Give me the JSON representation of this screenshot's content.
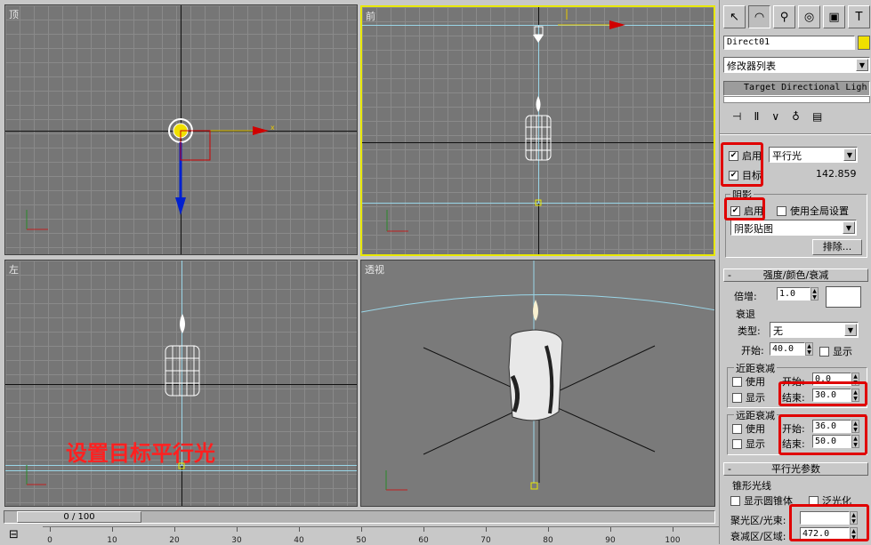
{
  "viewports": {
    "top": {
      "label": "顶"
    },
    "front": {
      "label": "前"
    },
    "left": {
      "label": "左"
    },
    "perspective": {
      "label": "透视"
    }
  },
  "caption": "设置目标平行光",
  "axis_labels": {
    "x": "x",
    "y": "y",
    "z": "z"
  },
  "command_panel": {
    "tabs": [
      "create-icon",
      "modify-icon",
      "hierarchy-icon",
      "motion-icon",
      "display-icon",
      "utilities-icon"
    ],
    "object_name": "Direct01",
    "object_color": "#f0e000",
    "modifier_list": "修改器列表",
    "stack_item": "Target Directional Ligh",
    "general": {
      "on_label": "启用",
      "light_type": "平行光",
      "target_label": "目标",
      "target_distance": "142.859",
      "shadow_group": "阴影",
      "shadow_on_label": "启用",
      "global_settings_label": "使用全局设置",
      "shadow_type": "阴影贴图",
      "exclude_button": "排除..."
    },
    "intensity_rollout": {
      "title": "强度/颜色/衰减",
      "multiplier_label": "倍增:",
      "multiplier_value": "1.0",
      "decay_group": "衰退",
      "type_label": "类型:",
      "type_value": "无",
      "start_label": "开始:",
      "start_value": "40.0",
      "show_label": "显示",
      "near_group": "近距衰减",
      "near_use": "使用",
      "near_start_label": "开始:",
      "near_start_value": "0.0",
      "near_show": "显示",
      "near_end_label": "结束:",
      "near_end_value": "30.0",
      "far_group": "远距衰减",
      "far_use": "使用",
      "far_start_label": "开始:",
      "far_start_value": "36.0",
      "far_show": "显示",
      "far_end_label": "结束:",
      "far_end_value": "50.0"
    },
    "directional_rollout": {
      "title": "平行光参数",
      "cone_group": "锥形光线",
      "show_cone": "显示圆锥体",
      "overshoot": "泛光化",
      "hotspot_label": "聚光区/光束:",
      "hotspot_value": "",
      "falloff_label": "衰减区/区域:",
      "falloff_value": "472.0"
    }
  },
  "timeline": {
    "frame_display": "0 / 100",
    "ticks": [
      "0",
      "10",
      "20",
      "30",
      "40",
      "50",
      "60",
      "70",
      "80",
      "90",
      "100"
    ]
  }
}
